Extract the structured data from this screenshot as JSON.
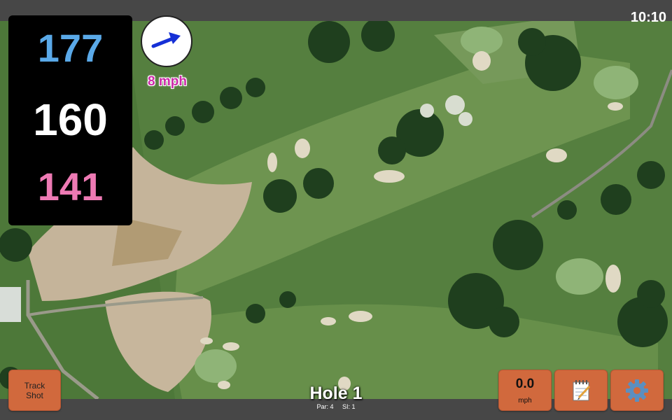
{
  "status": {
    "time": "10:10"
  },
  "distances": {
    "back": "177",
    "middle": "160",
    "front": "141"
  },
  "wind": {
    "speed": "8 mph",
    "icon": "wind-direction-arrow-icon"
  },
  "buttons": {
    "track_shot_line1": "Track",
    "track_shot_line2": "Shot",
    "speed_value": "0.0",
    "speed_unit": "mph",
    "notes_icon": "notepad-icon",
    "settings_icon": "gear-icon"
  },
  "hole": {
    "title": "Hole 1",
    "par": "Par: 4",
    "si": "SI: 1"
  },
  "colors": {
    "back": "#5aa9e8",
    "middle": "#ffffff",
    "front": "#ee7ab4",
    "button": "#d1693d",
    "wind_text": "#cc2aa9"
  }
}
